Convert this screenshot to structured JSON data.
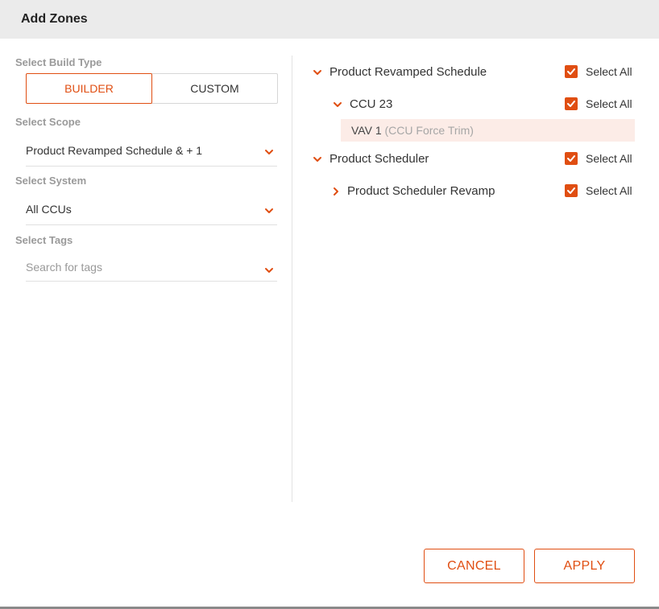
{
  "dialog": {
    "title": "Add Zones"
  },
  "left": {
    "build_type": {
      "label": "Select Build Type",
      "options": [
        "BUILDER",
        "CUSTOM"
      ],
      "selected": "BUILDER"
    },
    "scope": {
      "label": "Select Scope",
      "value": "Product Revamped Schedule & + 1"
    },
    "system": {
      "label": "Select System",
      "value": "All CCUs"
    },
    "tags": {
      "label": "Select Tags",
      "placeholder": "Search for tags"
    }
  },
  "tree": [
    {
      "label": "Product Revamped Schedule",
      "expanded": true,
      "select_all": "Select All",
      "checked": true
    },
    {
      "label": "CCU 23",
      "expanded": true,
      "select_all": "Select All",
      "checked": true
    },
    {
      "leaf_name": "VAV 1",
      "leaf_sub": "(CCU Force Trim)"
    },
    {
      "label": "Product Scheduler",
      "expanded": true,
      "select_all": "Select All",
      "checked": true
    },
    {
      "label": "Product Scheduler Revamp",
      "expanded": false,
      "select_all": "Select All",
      "checked": true
    }
  ],
  "actions": {
    "cancel": "CANCEL",
    "apply": "APPLY"
  },
  "colors": {
    "accent": "#e04e12",
    "header_bg": "#ebebeb",
    "highlight_bg": "#fcece7"
  },
  "icons": {
    "collapse": "chevron-down-icon",
    "expand": "chevron-right-icon",
    "check": "check-icon"
  }
}
